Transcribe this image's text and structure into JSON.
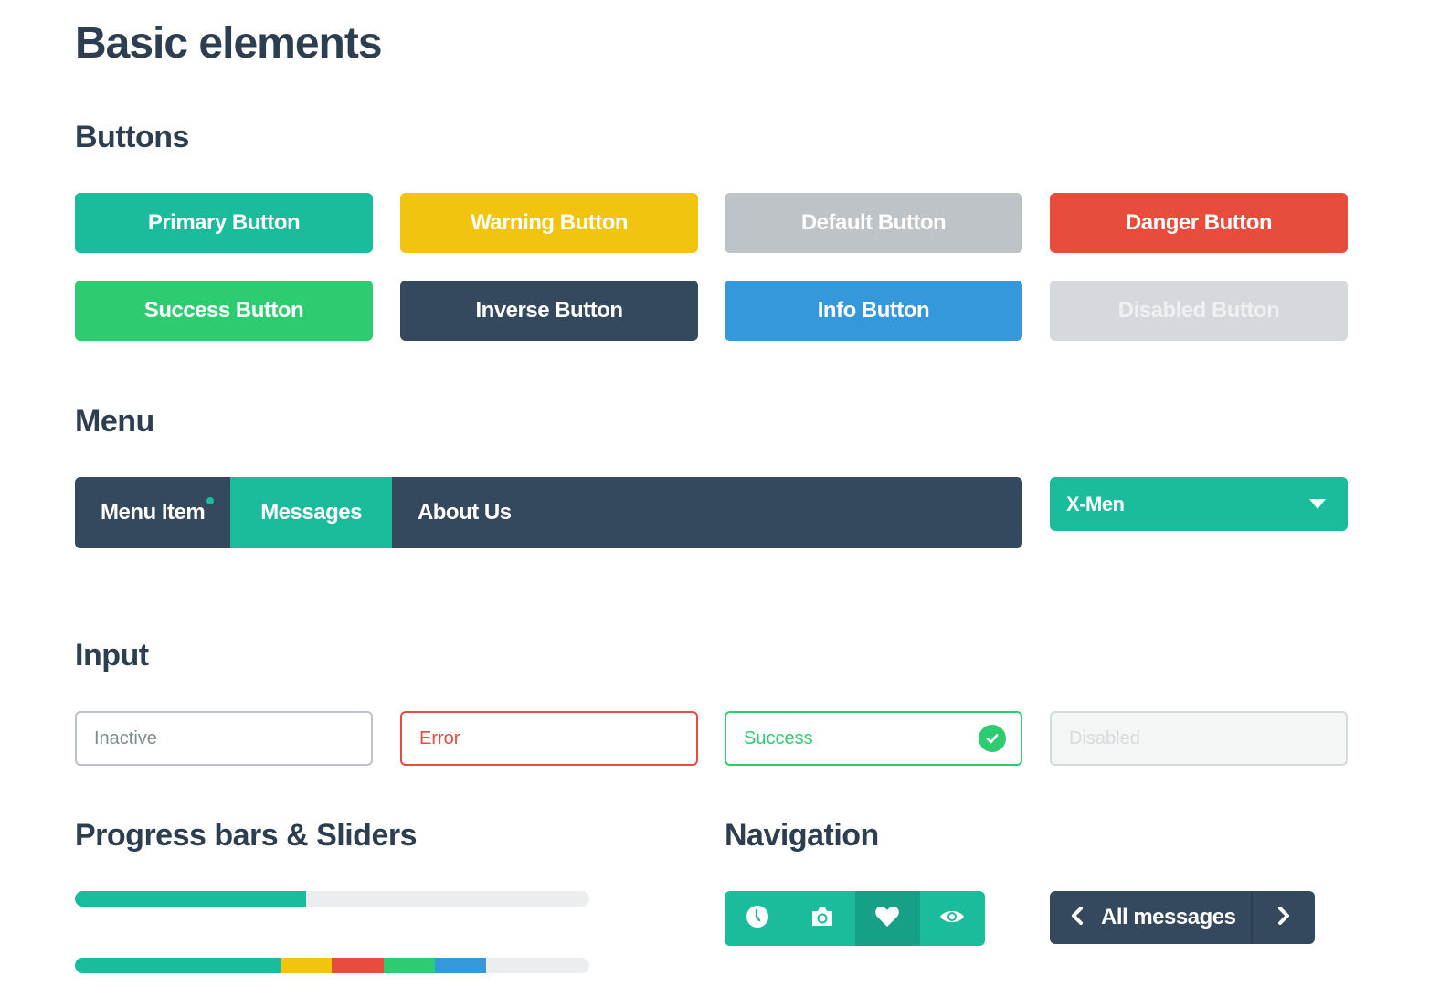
{
  "page_title": "Basic elements",
  "colors": {
    "primary": "#1abc9c",
    "warning": "#f1c40f",
    "default": "#bdc3c7",
    "danger": "#e74c3c",
    "success": "#2ecc71",
    "inverse": "#34495e",
    "info": "#3498db",
    "disabled": "#d5d8dc",
    "heading": "#2c3e50"
  },
  "sections": {
    "buttons": "Buttons",
    "menu": "Menu",
    "input": "Input",
    "progress": "Progress bars & Sliders",
    "navigation": "Navigation"
  },
  "buttons": [
    {
      "label": "Primary Button",
      "variant": "primary"
    },
    {
      "label": "Warning Button",
      "variant": "warning"
    },
    {
      "label": "Default Button",
      "variant": "default"
    },
    {
      "label": "Danger Button",
      "variant": "danger"
    },
    {
      "label": "Success Button",
      "variant": "success"
    },
    {
      "label": "Inverse Button",
      "variant": "inverse"
    },
    {
      "label": "Info Button",
      "variant": "info"
    },
    {
      "label": "Disabled Button",
      "variant": "disabled"
    }
  ],
  "menu": {
    "items": [
      {
        "label": "Menu Item",
        "has_notification_dot": true,
        "active": false
      },
      {
        "label": "Messages",
        "active": true
      },
      {
        "label": "About Us",
        "active": false
      }
    ],
    "select": {
      "value": "X-Men",
      "icon": "caret-down-icon"
    }
  },
  "inputs": [
    {
      "state": "inactive",
      "placeholder": "Inactive"
    },
    {
      "state": "error",
      "value": "Error"
    },
    {
      "state": "success",
      "value": "Success",
      "icon": "check-circle-icon"
    },
    {
      "state": "disabled",
      "placeholder": "Disabled"
    }
  ],
  "progress_bars": [
    {
      "segments": [
        {
          "color": "#1abc9c",
          "percent": 45
        }
      ]
    },
    {
      "segments": [
        {
          "color": "#1abc9c",
          "percent": 40
        },
        {
          "color": "#f1c40f",
          "percent": 10
        },
        {
          "color": "#e74c3c",
          "percent": 10
        },
        {
          "color": "#2ecc71",
          "percent": 10
        },
        {
          "color": "#3498db",
          "percent": 10
        }
      ]
    }
  ],
  "navigation": {
    "icon_bar": [
      {
        "icon": "clock-icon",
        "active": false
      },
      {
        "icon": "camera-icon",
        "active": false
      },
      {
        "icon": "heart-icon",
        "active": true
      },
      {
        "icon": "eye-icon",
        "active": false
      }
    ],
    "pager": {
      "label": "All messages",
      "prev_icon": "chevron-left-icon",
      "next_icon": "chevron-right-icon"
    }
  }
}
